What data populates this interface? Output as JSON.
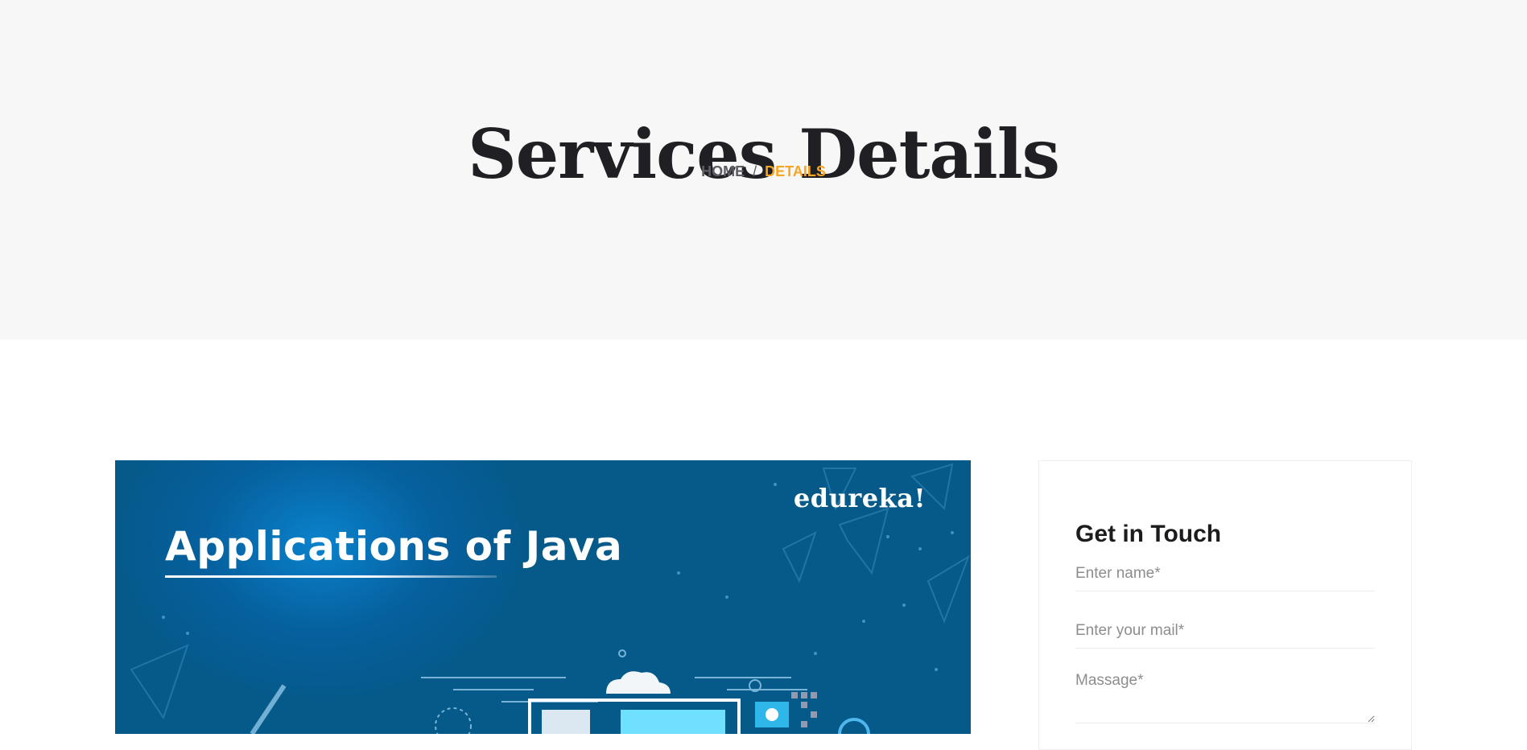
{
  "hero": {
    "title": "Services Details",
    "breadcrumb": {
      "home": "HOME",
      "separator": "/",
      "current": "DETAILS"
    }
  },
  "service_image": {
    "brand": "edureka!",
    "heading": "Applications of Java"
  },
  "contact": {
    "title": "Get in Touch",
    "name_placeholder": "Enter name*",
    "mail_placeholder": "Enter your mail*",
    "message_placeholder": "Massage*"
  },
  "colors": {
    "accent": "#f6a623",
    "hero_bg": "#f7f7f7",
    "image_bg": "#06609e"
  }
}
